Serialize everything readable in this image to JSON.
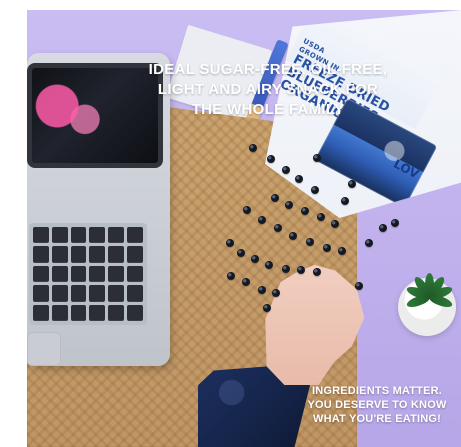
{
  "headline": {
    "lines": [
      "IDEAL SUGAR-FREE, OIL-FREE,",
      "LIGHT AND AIRY SNACK FOR",
      "THE WHOLE FAMILY"
    ]
  },
  "package": {
    "small_top_lines": [
      "USDA",
      "GROWN IN"
    ],
    "main_lines": [
      "FREEZE DRIED",
      "BLUEBERRIES",
      "ORGANIC WI..."
    ],
    "brand_mark": "LOV"
  },
  "footer_message": {
    "lines": [
      "INGREDIENTS MATTER.",
      "YOU DESERVE TO KNOW",
      "WHAT YOU'RE EATING!"
    ]
  },
  "colors": {
    "background": "#c7b8f1",
    "package_blue": "#2951a4",
    "berry": "#141820",
    "mat": "#c7a06b",
    "text": "#ffffff"
  }
}
